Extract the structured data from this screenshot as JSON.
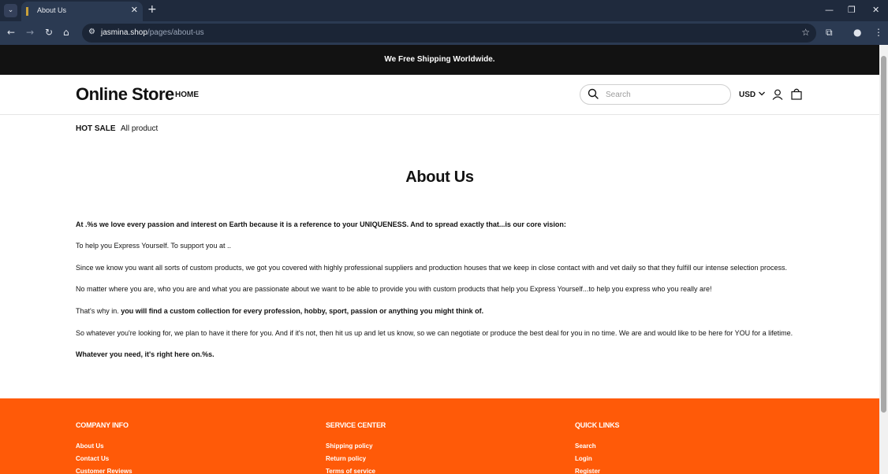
{
  "browser": {
    "tab_title": "About Us",
    "url_host": "jasmina.shop",
    "url_path": "/pages/about-us"
  },
  "announcement": "We Free Shipping Worldwide.",
  "header": {
    "logo": "Online Store",
    "nav_home": "HOME",
    "search_placeholder": "Search",
    "currency": "USD"
  },
  "subnav": {
    "items": [
      "HOT SALE",
      "All product"
    ]
  },
  "page": {
    "title": "About Us",
    "paragraphs": [
      "At .%s we love every passion and interest on Earth because it is a reference to your UNIQUENESS. And to spread exactly that...is our core vision:",
      "To help you Express Yourself. To support you at ..",
      "Since we know you want all sorts of custom products, we got you covered with highly professional suppliers and production houses that we keep in close contact with and vet daily so that they fulfill our intense selection process.",
      "No matter where you are, who you are and what you are passionate about we want to be able to provide you with custom products that help you Express Yourself...to help you express who you really are!",
      "That's why in. ",
      "you will find a custom collection for every profession, hobby, sport, passion or anything you might think of.",
      "So whatever you're looking for, we plan to have it there for you. And if it's not, then hit us up and let us know, so we can negotiate or produce the best deal for you in no time. We are and would like to be here for YOU for a lifetime.",
      "Whatever you need, it's right here on.%s."
    ]
  },
  "footer": {
    "company_info": {
      "heading": "COMPANY INFO",
      "links": [
        "About Us",
        "Contact Us",
        "Customer Reviews"
      ]
    },
    "service_center": {
      "heading": "SERVICE CENTER",
      "links": [
        "Shipping policy",
        "Return policy",
        "Terms of service"
      ]
    },
    "quick_links": {
      "heading": "QUICK LINKS",
      "links": [
        "Search",
        "Login",
        "Register"
      ]
    }
  }
}
